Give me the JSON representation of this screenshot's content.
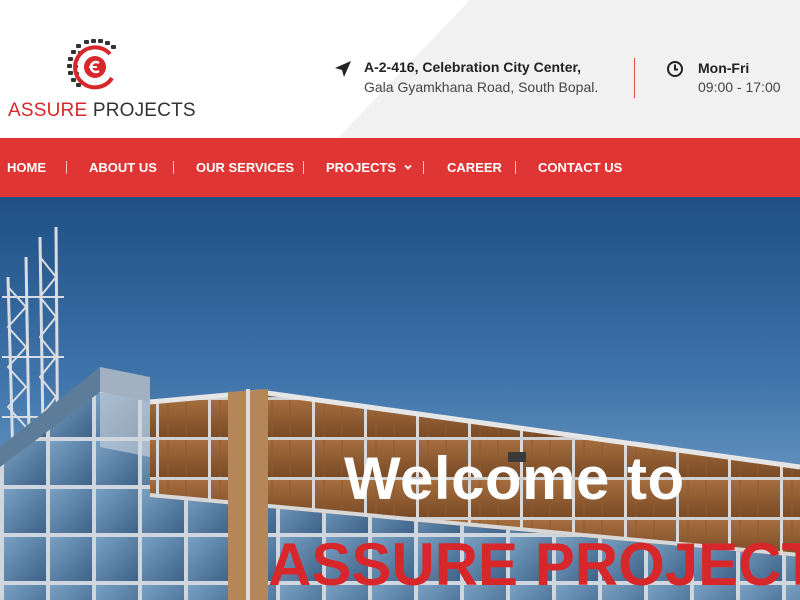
{
  "brand": {
    "name_part1": "ASSURE",
    "name_part2": "PROJECTS",
    "logo_icon": "assure-projects-logo-mark"
  },
  "contact": {
    "address_icon": "location-arrow-icon",
    "address_line1": "A-2-416, Celebration City Center,",
    "address_line2": "Gala Gyamkhana Road, South Bopal.",
    "hours_icon": "clock-icon",
    "hours_days": "Mon-Fri",
    "hours_time": "09:00 - 17:00"
  },
  "nav": {
    "items": [
      {
        "label": "HOME"
      },
      {
        "label": "ABOUT US"
      },
      {
        "label": "OUR SERVICES"
      },
      {
        "label": "PROJECTS",
        "has_dropdown": true,
        "dropdown_icon": "chevron-down-icon"
      },
      {
        "label": "CAREER"
      },
      {
        "label": "CONTACT US"
      }
    ]
  },
  "hero": {
    "title_line1": "Welcome to",
    "title_line2": "ASSURE PROJECTS"
  },
  "colors": {
    "brand_red": "#df3535",
    "title_red": "#d8272b",
    "text_dark": "#222222",
    "header_grey": "#f2f2f2"
  }
}
